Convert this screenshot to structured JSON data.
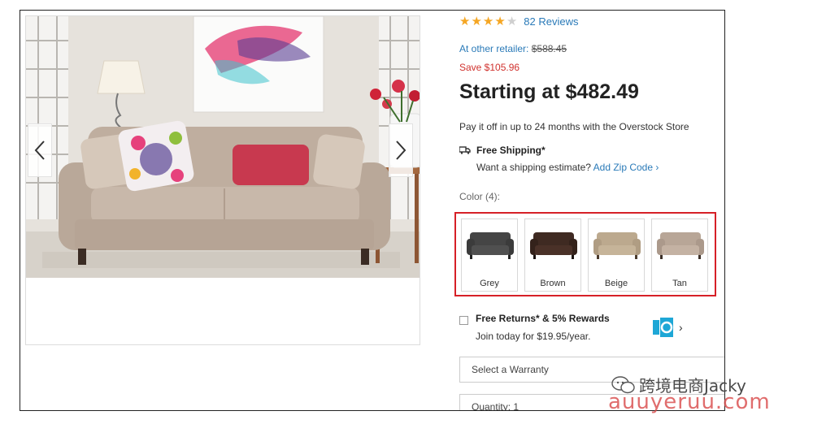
{
  "product": {
    "rating": {
      "stars_filled": 4,
      "stars_total": 5,
      "reviews_label": "82 Reviews"
    },
    "retailer": {
      "label": "At other retailer:",
      "price": "$588.45"
    },
    "save_label": "Save $105.96",
    "price_label": "Starting at $482.49",
    "payoff_label": "Pay it off in up to 24 months with the Overstock Store",
    "shipping": {
      "title": "Free Shipping*",
      "question": "Want a shipping estimate?",
      "link": "Add Zip Code"
    },
    "color_label": "Color (4):",
    "colors": [
      {
        "name": "Grey",
        "hex": "#454545"
      },
      {
        "name": "Brown",
        "hex": "#3f2a22"
      },
      {
        "name": "Beige",
        "hex": "#bca98e"
      },
      {
        "name": "Tan",
        "hex": "#b8a697"
      }
    ],
    "returns": {
      "title": "Free Returns* & 5% Rewards",
      "subtitle": "Join today for $19.95/year."
    },
    "warranty_placeholder": "Select a Warranty",
    "quantity_label": "Quantity: 1"
  },
  "watermark": {
    "line1": "跨境电商Jacky",
    "line2": "auuyeruu.com"
  },
  "colors": {
    "accent_link": "#2a7ab8",
    "save_red": "#d0312d",
    "highlight_border": "#d62027",
    "star": "#f5a623"
  }
}
